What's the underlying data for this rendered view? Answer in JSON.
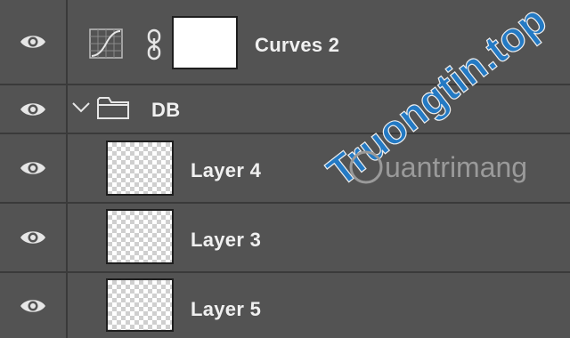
{
  "layers": [
    {
      "name": "Curves 2",
      "visible": true,
      "kind": "adjustment-curves",
      "icons": [
        "eye-icon",
        "curves-adjustment-icon",
        "link-icon"
      ]
    },
    {
      "name": "DB",
      "visible": true,
      "kind": "group",
      "expanded": true,
      "icons": [
        "eye-icon",
        "chevron-down-icon",
        "folder-icon"
      ]
    },
    {
      "name": "Layer 4",
      "visible": true,
      "kind": "pixel",
      "icons": [
        "eye-icon"
      ]
    },
    {
      "name": "Layer 3",
      "visible": true,
      "kind": "pixel",
      "icons": [
        "eye-icon"
      ]
    },
    {
      "name": "Layer 5",
      "visible": true,
      "kind": "pixel",
      "icons": [
        "eye-icon"
      ]
    }
  ],
  "watermark": {
    "primary": "Truongtin.top",
    "secondary": "uantrimang",
    "colors": {
      "primary": "#1f7fd1",
      "secondary": "#c62828",
      "logo_text": "#9a9a9a"
    }
  },
  "colors": {
    "panel_bg": "#535353",
    "divider": "#3a3a3a",
    "text": "#f0f0f0",
    "icon": "#e6e6e6"
  }
}
